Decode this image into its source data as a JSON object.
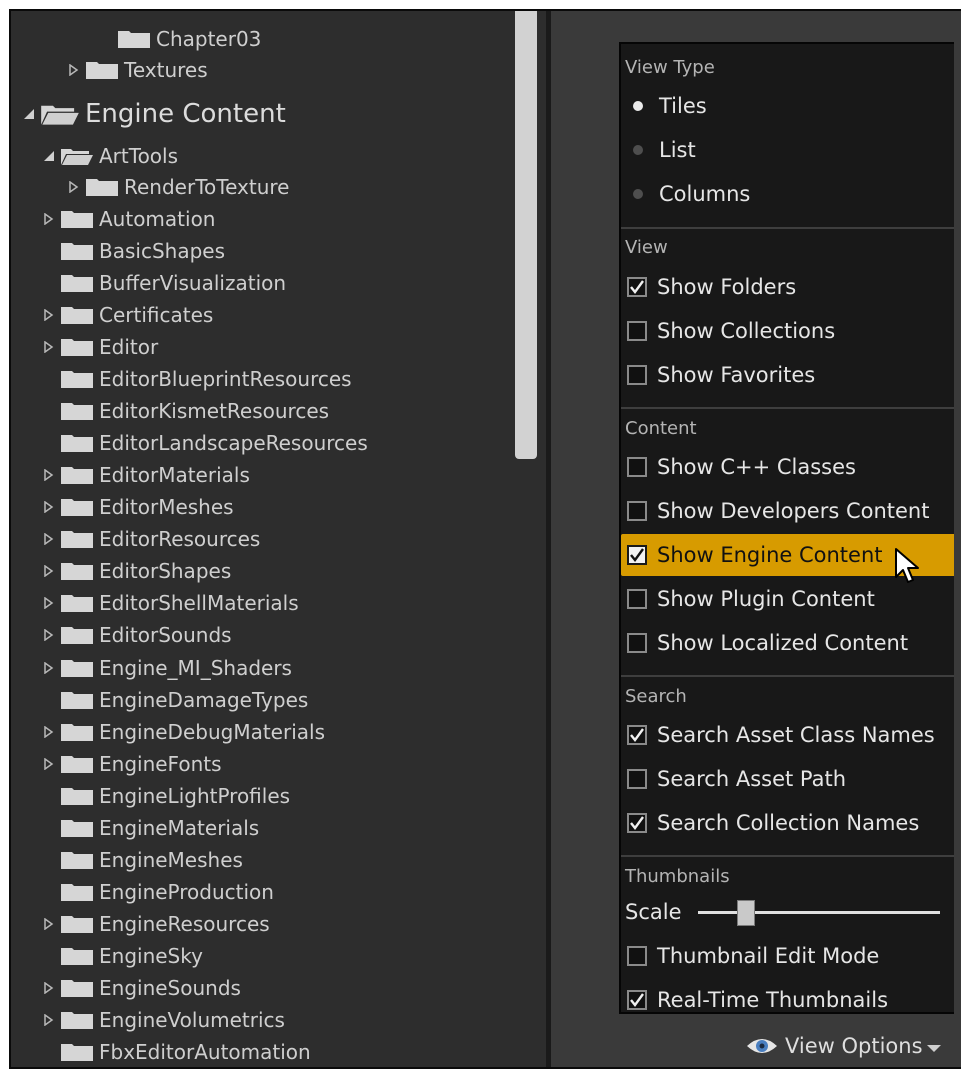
{
  "tree": {
    "items": [
      {
        "label": "Chapter03",
        "indent": 3,
        "expander": "none"
      },
      {
        "label": "Textures",
        "indent": 2,
        "expander": "collapsed"
      },
      {
        "label": "Engine Content",
        "indent": 0,
        "expander": "expanded",
        "big": true
      },
      {
        "label": "ArtTools",
        "indent": 1,
        "expander": "expanded"
      },
      {
        "label": "RenderToTexture",
        "indent": 2,
        "expander": "collapsed"
      },
      {
        "label": "Automation",
        "indent": 1,
        "expander": "collapsed"
      },
      {
        "label": "BasicShapes",
        "indent": 1,
        "expander": "none"
      },
      {
        "label": "BufferVisualization",
        "indent": 1,
        "expander": "none"
      },
      {
        "label": "Certificates",
        "indent": 1,
        "expander": "collapsed"
      },
      {
        "label": "Editor",
        "indent": 1,
        "expander": "collapsed"
      },
      {
        "label": "EditorBlueprintResources",
        "indent": 1,
        "expander": "none"
      },
      {
        "label": "EditorKismetResources",
        "indent": 1,
        "expander": "none"
      },
      {
        "label": "EditorLandscapeResources",
        "indent": 1,
        "expander": "none"
      },
      {
        "label": "EditorMaterials",
        "indent": 1,
        "expander": "collapsed"
      },
      {
        "label": "EditorMeshes",
        "indent": 1,
        "expander": "collapsed"
      },
      {
        "label": "EditorResources",
        "indent": 1,
        "expander": "collapsed"
      },
      {
        "label": "EditorShapes",
        "indent": 1,
        "expander": "collapsed"
      },
      {
        "label": "EditorShellMaterials",
        "indent": 1,
        "expander": "collapsed"
      },
      {
        "label": "EditorSounds",
        "indent": 1,
        "expander": "collapsed"
      },
      {
        "label": "Engine_MI_Shaders",
        "indent": 1,
        "expander": "collapsed"
      },
      {
        "label": "EngineDamageTypes",
        "indent": 1,
        "expander": "none"
      },
      {
        "label": "EngineDebugMaterials",
        "indent": 1,
        "expander": "collapsed"
      },
      {
        "label": "EngineFonts",
        "indent": 1,
        "expander": "collapsed"
      },
      {
        "label": "EngineLightProfiles",
        "indent": 1,
        "expander": "none"
      },
      {
        "label": "EngineMaterials",
        "indent": 1,
        "expander": "none"
      },
      {
        "label": "EngineMeshes",
        "indent": 1,
        "expander": "none"
      },
      {
        "label": "EngineProduction",
        "indent": 1,
        "expander": "none"
      },
      {
        "label": "EngineResources",
        "indent": 1,
        "expander": "collapsed"
      },
      {
        "label": "EngineSky",
        "indent": 1,
        "expander": "none"
      },
      {
        "label": "EngineSounds",
        "indent": 1,
        "expander": "collapsed"
      },
      {
        "label": "EngineVolumetrics",
        "indent": 1,
        "expander": "collapsed"
      },
      {
        "label": "FbxEditorAutomation",
        "indent": 1,
        "expander": "none"
      }
    ]
  },
  "menu": {
    "view_type": {
      "header": "View Type",
      "options": [
        {
          "label": "Tiles",
          "selected": true
        },
        {
          "label": "List",
          "selected": false
        },
        {
          "label": "Columns",
          "selected": false
        }
      ]
    },
    "view": {
      "header": "View",
      "items": [
        {
          "label": "Show Folders",
          "checked": true,
          "submenu": true
        },
        {
          "label": "Show Collections",
          "checked": false
        },
        {
          "label": "Show Favorites",
          "checked": false
        }
      ]
    },
    "content": {
      "header": "Content",
      "items": [
        {
          "label": "Show C++ Classes",
          "checked": false
        },
        {
          "label": "Show Developers Content",
          "checked": false
        },
        {
          "label": "Show Engine Content",
          "checked": true,
          "highlighted": true
        },
        {
          "label": "Show Plugin Content",
          "checked": false
        },
        {
          "label": "Show Localized Content",
          "checked": false
        }
      ]
    },
    "search": {
      "header": "Search",
      "items": [
        {
          "label": "Search Asset Class Names",
          "checked": true
        },
        {
          "label": "Search Asset Path",
          "checked": false
        },
        {
          "label": "Search Collection Names",
          "checked": true
        }
      ]
    },
    "thumbnails": {
      "header": "Thumbnails",
      "scale_label": "Scale",
      "scale_value": 0.2,
      "items": [
        {
          "label": "Thumbnail Edit Mode",
          "checked": false
        },
        {
          "label": "Real-Time Thumbnails",
          "checked": true
        }
      ]
    }
  },
  "view_options_button": {
    "label": "View Options",
    "icon": "eye-icon"
  },
  "colors": {
    "highlight": "#d79b00",
    "panel": "#2d2d2d",
    "menu": "#181818"
  }
}
